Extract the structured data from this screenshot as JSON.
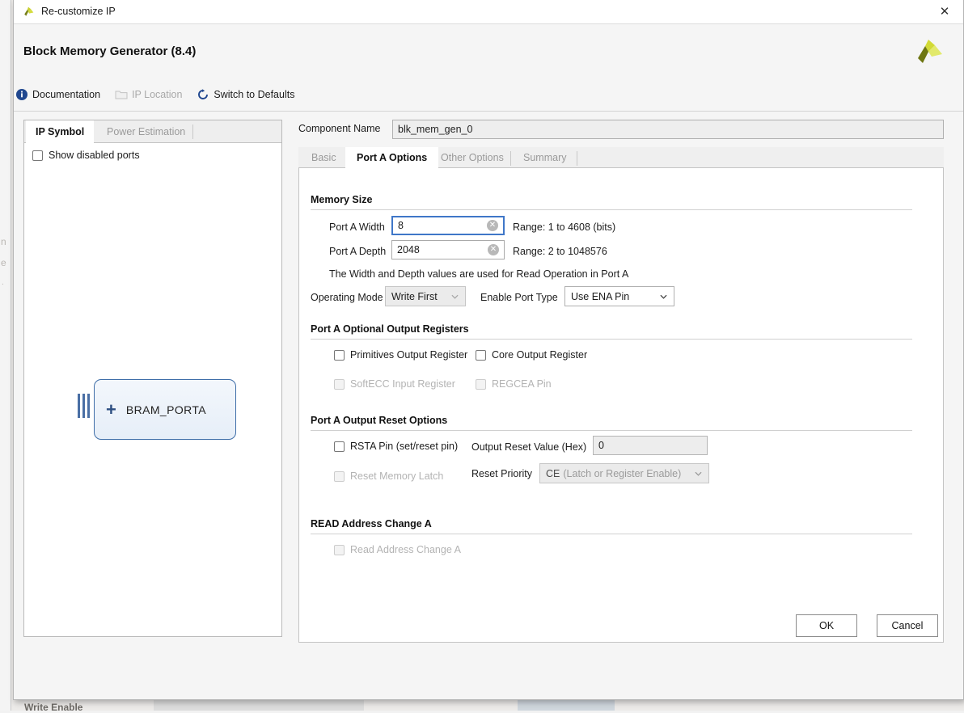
{
  "window": {
    "title": "Re-customize IP",
    "close_label": "✕",
    "logo_icon": "xilinx-logo-icon"
  },
  "header": {
    "ip_title": "Block Memory Generator (8.4)",
    "brand_logo_icon": "xilinx-brand-logo-icon",
    "tools": [
      {
        "label": "Documentation",
        "icon": "info-icon",
        "enabled": true
      },
      {
        "label": "IP Location",
        "icon": "folder-icon",
        "enabled": false
      },
      {
        "label": "Switch to Defaults",
        "icon": "refresh-icon",
        "enabled": true
      }
    ]
  },
  "left_panel": {
    "tabs": [
      {
        "label": "IP Symbol",
        "active": true
      },
      {
        "label": "Power Estimation",
        "active": false
      }
    ],
    "show_disabled_ports": {
      "label": "Show disabled ports",
      "checked": false
    },
    "symbol": {
      "label": "BRAM_PORTA",
      "expander": "+"
    }
  },
  "right_panel": {
    "component_name_label": "Component Name",
    "component_name_value": "blk_mem_gen_0",
    "tabs": [
      {
        "label": "Basic",
        "active": false
      },
      {
        "label": "Port A Options",
        "active": true
      },
      {
        "label": "Other Options",
        "active": false
      },
      {
        "label": "Summary",
        "active": false
      }
    ],
    "memory_size": {
      "title": "Memory Size",
      "width_label": "Port A Width",
      "width_value": "8",
      "width_range": "Range: 1 to 4608 (bits)",
      "depth_label": "Port A Depth",
      "depth_value": "2048",
      "depth_range": "Range: 2 to 1048576",
      "note": "The Width and Depth values are used for Read Operation in Port A",
      "operating_mode_label": "Operating Mode",
      "operating_mode_value": "Write First",
      "enable_port_type_label": "Enable Port Type",
      "enable_port_type_value": "Use ENA Pin"
    },
    "optional_output_registers": {
      "title": "Port A Optional Output Registers",
      "items": [
        {
          "label": "Primitives Output Register",
          "checked": false,
          "enabled": true
        },
        {
          "label": "Core Output Register",
          "checked": false,
          "enabled": true
        },
        {
          "label": "SoftECC Input Register",
          "checked": false,
          "enabled": false
        },
        {
          "label": "REGCEA Pin",
          "checked": false,
          "enabled": false
        }
      ]
    },
    "output_reset_options": {
      "title": "Port A Output Reset Options",
      "rsta_label": "RSTA Pin (set/reset pin)",
      "reset_memory_latch_label": "Reset Memory Latch",
      "output_reset_value_label": "Output Reset Value (Hex)",
      "output_reset_value": "0",
      "reset_priority_label": "Reset Priority",
      "reset_priority_value": "CE",
      "reset_priority_hint": "(Latch or Register Enable)"
    },
    "read_address_change": {
      "title": "READ Address Change A",
      "checkbox_label": "Read Address Change A"
    }
  },
  "footer": {
    "ok_label": "OK",
    "cancel_label": "Cancel"
  },
  "background": {
    "partial_label": "Write Enable"
  }
}
